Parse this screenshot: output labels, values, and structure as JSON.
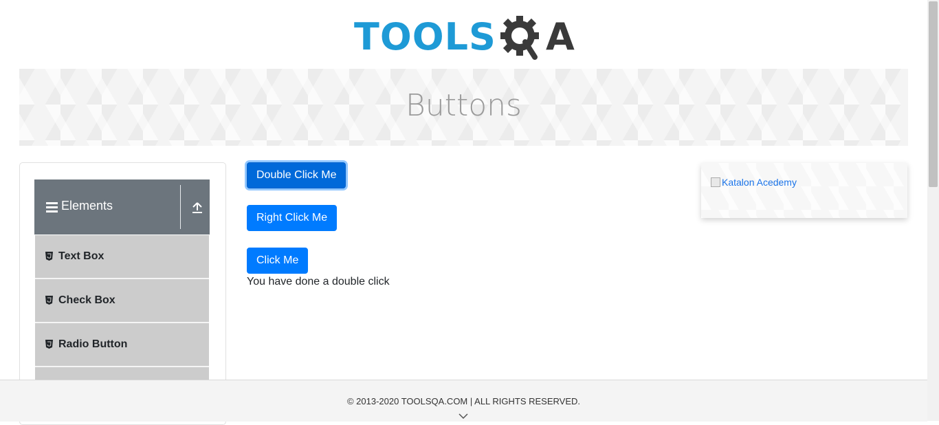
{
  "header": {
    "logo_part1": "TOOLS",
    "logo_part2": "A"
  },
  "banner": {
    "title": "Buttons"
  },
  "sidebar": {
    "group_title": "Elements",
    "items": [
      {
        "label": "Text Box"
      },
      {
        "label": "Check Box"
      },
      {
        "label": "Radio Button"
      }
    ]
  },
  "main": {
    "double_click_label": "Double Click Me",
    "right_click_label": "Right Click Me",
    "click_label": "Click Me",
    "result_message": "You have done a double click"
  },
  "ad": {
    "alt_text": "Katalon Acedemy"
  },
  "footer": {
    "copyright": "© 2013-2020 TOOLSQA.COM | ALL RIGHTS RESERVED."
  },
  "colors": {
    "primary": "#007bff",
    "logo_blue": "#1e9ad6",
    "sidebar_header": "#6c757d",
    "menu_item_bg": "#cccccc"
  }
}
